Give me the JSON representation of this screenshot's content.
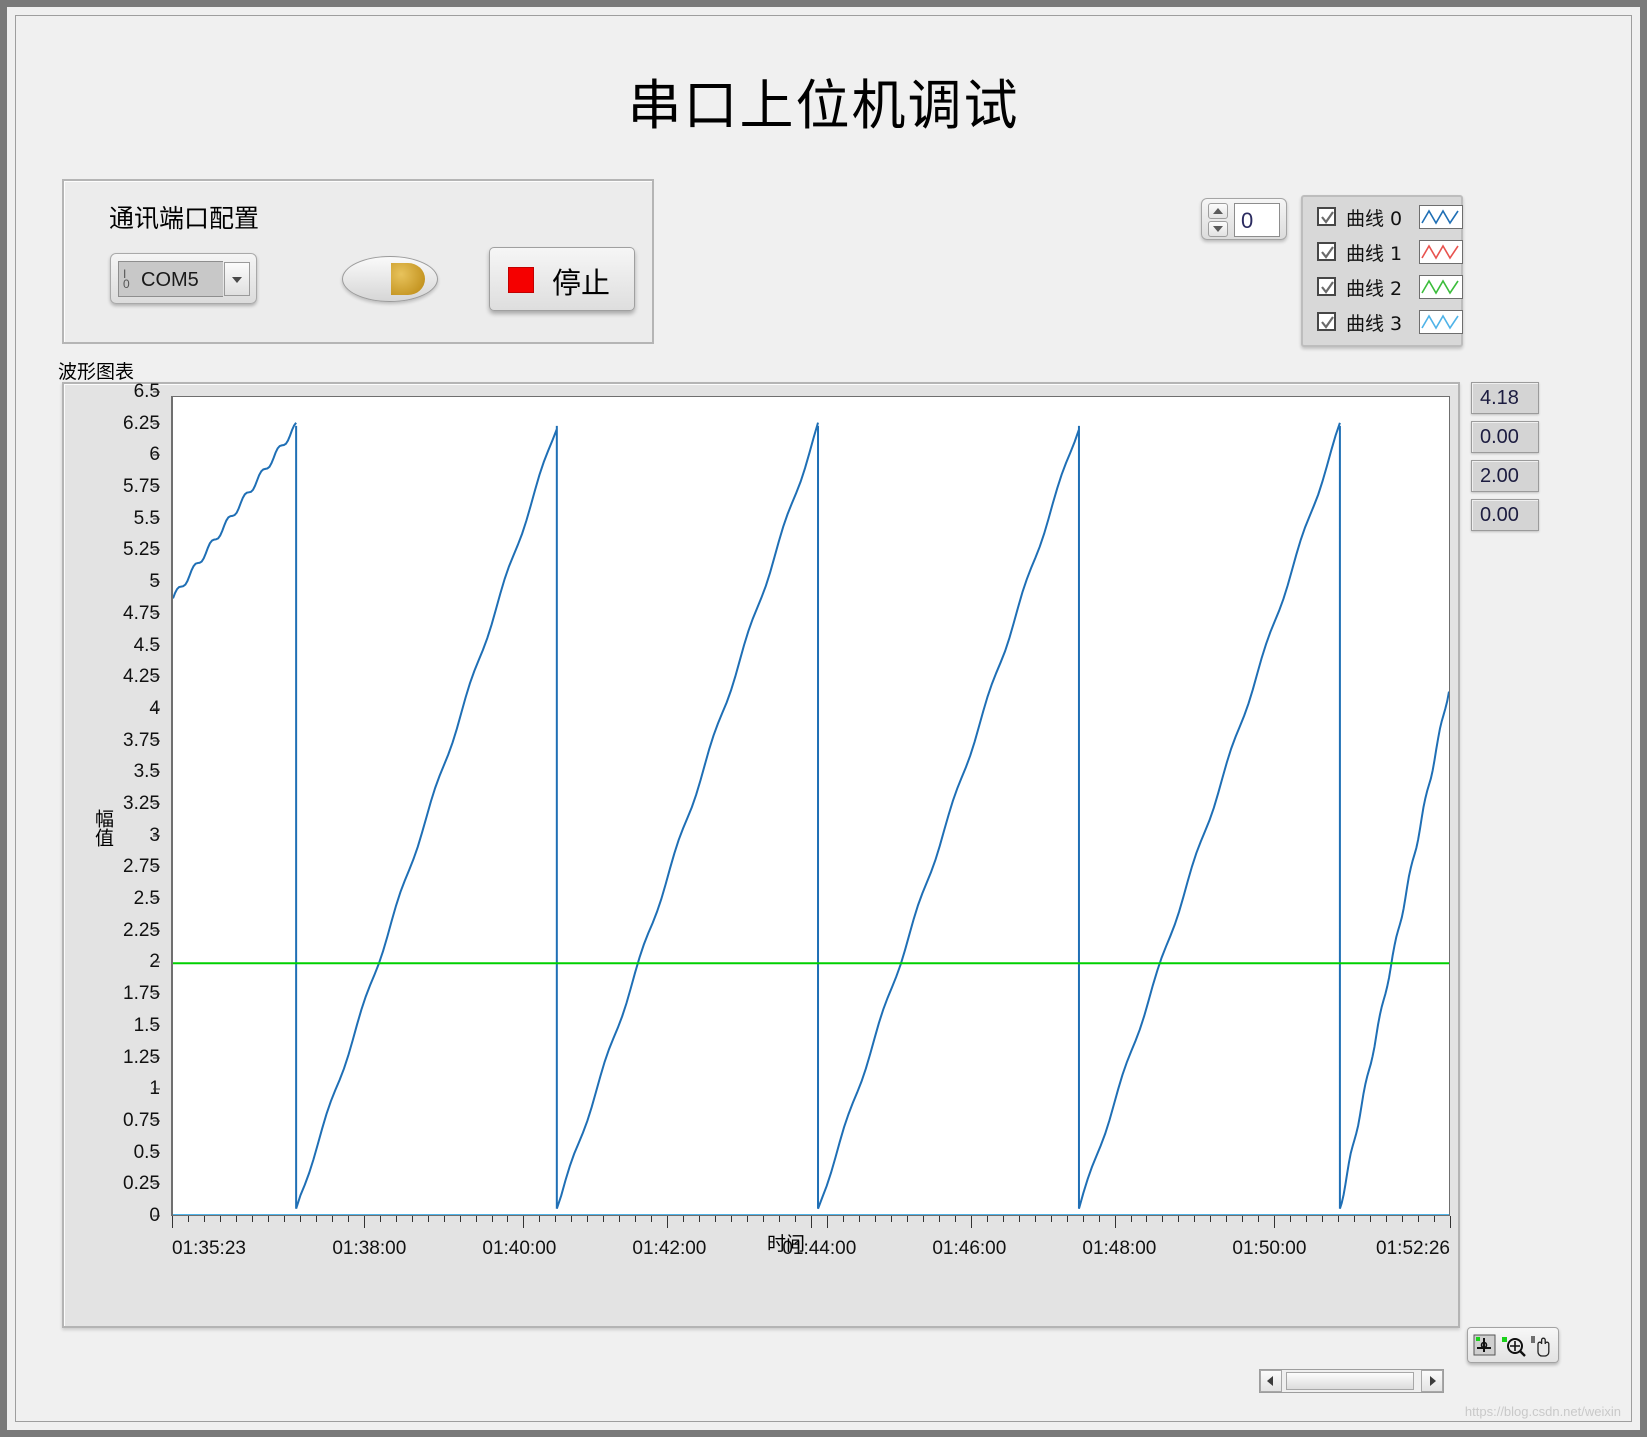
{
  "window": {
    "title": "串口上位机调试"
  },
  "comm_group": {
    "title": "通讯端口配置",
    "port_select": {
      "value": "COM5",
      "io_top": "I",
      "io_bottom": "0"
    },
    "led": {
      "name": "activity-led"
    },
    "stop_button": {
      "label": "停止"
    }
  },
  "spin_control": {
    "value": "0"
  },
  "legend": {
    "items": [
      {
        "label": "曲线 0",
        "checked": true,
        "color": "#1f6fb5"
      },
      {
        "label": "曲线 1",
        "checked": true,
        "color": "#e8534f"
      },
      {
        "label": "曲线 2",
        "checked": true,
        "color": "#3bbd3b"
      },
      {
        "label": "曲线 3",
        "checked": true,
        "color": "#4fb3e8"
      }
    ]
  },
  "chart_label": "波形图表",
  "indicators": [
    {
      "value": "4.18"
    },
    {
      "value": "0.00"
    },
    {
      "value": "2.00"
    },
    {
      "value": "0.00"
    }
  ],
  "palette": {
    "buttons": [
      {
        "name": "cursor-move-tool"
      },
      {
        "name": "zoom-tool"
      },
      {
        "name": "pan-hand-tool"
      }
    ]
  },
  "scrollbar": {
    "left_arrow": "◀",
    "right_arrow": "▶"
  },
  "watermark": "https://blog.csdn.net/weixin",
  "chart_data": {
    "type": "line",
    "title": "波形图表",
    "xlabel": "时间",
    "ylabel": "幅值",
    "grid": false,
    "legend_position": "top-right",
    "ylim": [
      0,
      6.5
    ],
    "ytick_step": 0.25,
    "yticks": [
      0,
      0.25,
      0.5,
      0.75,
      1,
      1.25,
      1.5,
      1.75,
      2,
      2.25,
      2.5,
      2.75,
      3,
      3.25,
      3.5,
      3.75,
      4,
      4.25,
      4.5,
      4.75,
      5,
      5.25,
      5.5,
      5.75,
      6,
      6.25,
      6.5
    ],
    "ytick_labels": [
      "0",
      "0.25",
      "0.5",
      "0.75",
      "1",
      "1.25",
      "1.5",
      "1.75",
      "2",
      "2.25",
      "2.5",
      "2.75",
      "3",
      "3.25",
      "3.5",
      "3.75",
      "4",
      "4.25",
      "4.5",
      "4.75",
      "5",
      "5.25",
      "5.5",
      "5.75",
      "6",
      "6.25",
      "6.5"
    ],
    "xlim": [
      "01:35:23",
      "01:52:26"
    ],
    "xtick_labels": [
      "01:35:23",
      "01:38:00",
      "01:40:00",
      "01:42:00",
      "01:44:00",
      "01:46:00",
      "01:48:00",
      "01:50:00",
      "01:52:26"
    ],
    "xtick_positions": [
      0,
      0.1544,
      0.2718,
      0.3892,
      0.5065,
      0.6239,
      0.7413,
      0.8587,
      1.0
    ],
    "series": [
      {
        "name": "曲线 0",
        "color": "#1f6fb5",
        "kind": "sawtooth",
        "ymin": 0.05,
        "ymax": 6.27,
        "period": 0.2045,
        "phase_start_value": 4.9,
        "end_value": 4.18,
        "reset_x": [
          0.0965,
          0.3008,
          0.5055,
          0.71,
          0.9145
        ]
      },
      {
        "name": "曲线 1",
        "color": "#f2645f",
        "kind": "constant",
        "value": 0.0
      },
      {
        "name": "曲线 2",
        "color": "#00d000",
        "kind": "constant",
        "value": 2.0
      },
      {
        "name": "曲线 3",
        "color": "#4fb3e8",
        "kind": "constant",
        "value": 0.0
      }
    ]
  }
}
